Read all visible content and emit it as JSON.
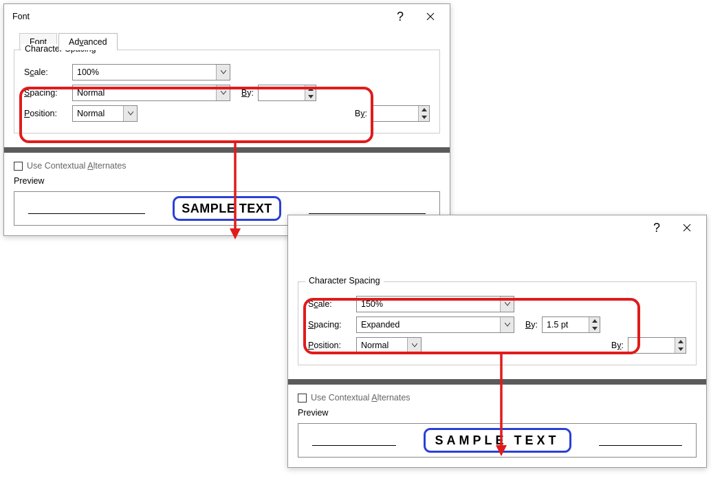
{
  "dialog1": {
    "title": "Font",
    "tabs": {
      "font": "Font",
      "advanced": "Advanced"
    },
    "group_label": "Character Spacing",
    "scale_label": "Scale:",
    "scale_value": "100%",
    "spacing_label": "Spacing:",
    "spacing_value": "Normal",
    "by_label": "By:",
    "by_value": "",
    "position_label": "Position:",
    "position_value": "Normal",
    "pos_by_label": "By:",
    "pos_by_value": "",
    "context_alt": "Use Contextual Alternates",
    "preview_label": "Preview",
    "preview_text": "SAMPLE TEXT"
  },
  "dialog2": {
    "group_label": "Character Spacing",
    "scale_label": "Scale:",
    "scale_value": "150%",
    "spacing_label": "Spacing:",
    "spacing_value": "Expanded",
    "by_label": "By:",
    "by_value": "1.5 pt",
    "position_label": "Position:",
    "position_value": "Normal",
    "pos_by_label": "By:",
    "pos_by_value": "",
    "context_alt": "Use Contextual Alternates",
    "preview_label": "Preview",
    "preview_text": "SAMPLE TEXT"
  }
}
